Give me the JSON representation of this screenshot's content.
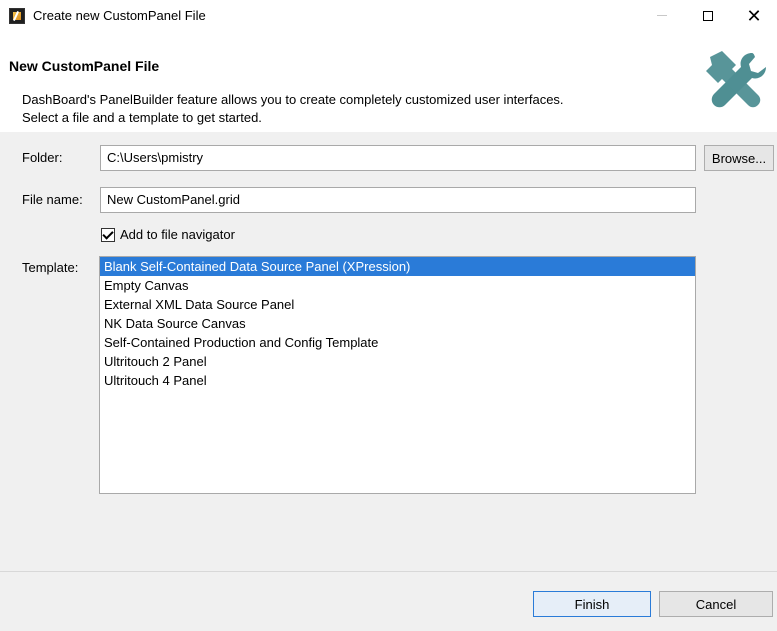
{
  "window": {
    "title": "Create new CustomPanel File",
    "minimize_label": "minimize",
    "maximize_label": "maximize",
    "close_label": "close"
  },
  "banner": {
    "title": "New CustomPanel File",
    "description_line1": "DashBoard's PanelBuilder feature allows you to create completely customized user interfaces.",
    "description_line2": "Select a file and a template to get started.",
    "icon": "tools-icon"
  },
  "form": {
    "folder_label": "Folder:",
    "folder_value": "C:\\Users\\pmistry",
    "browse_label": "Browse...",
    "file_name_label": "File name:",
    "file_name_value": "New CustomPanel.grid",
    "add_to_navigator_label": "Add to file navigator",
    "add_to_navigator_checked": true,
    "template_label": "Template:",
    "templates": [
      "Blank Self-Contained Data Source Panel (XPression)",
      "Empty Canvas",
      "External XML Data Source Panel",
      "NK Data Source Canvas",
      "Self-Contained Production and Config Template",
      "Ultritouch 2 Panel",
      "Ultritouch 4 Panel"
    ],
    "selected_template_index": 0
  },
  "footer": {
    "finish_label": "Finish",
    "cancel_label": "Cancel"
  },
  "colors": {
    "selection": "#2a7bd8",
    "dialog_bg": "#f0f0f0",
    "icon_teal": "#4f8f93"
  }
}
